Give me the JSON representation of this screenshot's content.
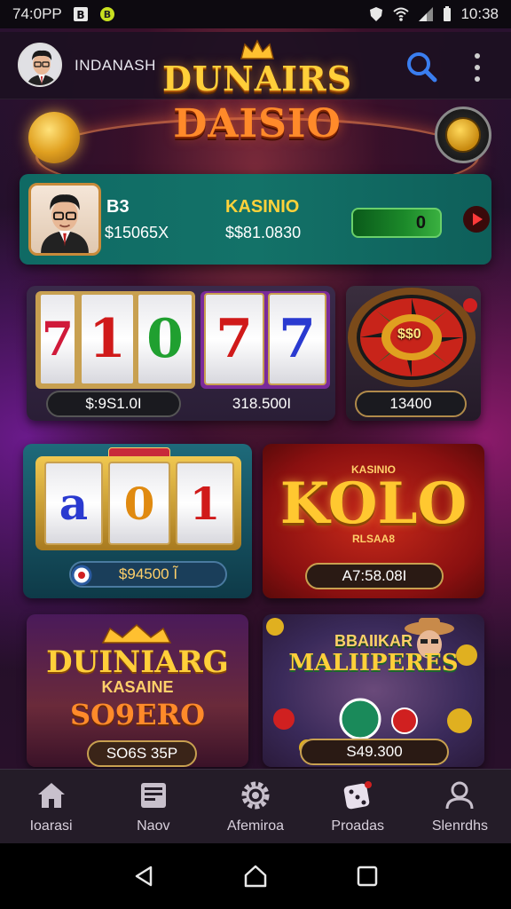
{
  "status_bar": {
    "time_left": "74:0PP",
    "time_right": "10:38"
  },
  "header": {
    "user_name": "INDANASH",
    "logo_line1": "DUNAIRS",
    "logo_line2": "DAISIO"
  },
  "profile": {
    "id": "B3",
    "balance": "$15065X",
    "label": "KASINIO",
    "balance2": "$$81.0830",
    "toggle_value": "0"
  },
  "games": [
    {
      "reels": [
        "7",
        "1",
        "1",
        "0",
        "7",
        "7",
        "7"
      ],
      "price": "$:9S1.0I",
      "price2": "318.500I"
    },
    {
      "title": "$$0",
      "price": "13400"
    },
    {
      "badge": "RŠŠŠŠ",
      "reels": [
        "a",
        "0",
        "1"
      ],
      "price": "$94500 Ĩ"
    },
    {
      "title": "KOLO",
      "top": "KASINIO",
      "bottom": "RLSAA8",
      "price": "A7:58.08I"
    },
    {
      "line1": "DUINIARG",
      "line2": "KASAINE",
      "line3": "SO9ERO",
      "price": "SO6S 35P"
    },
    {
      "line1": "BBAIIKAR",
      "line2": "MALIIPERES",
      "price": "S49.300"
    }
  ],
  "nav": [
    {
      "label": "Ioarasi",
      "icon": "home-icon"
    },
    {
      "label": "Naov",
      "icon": "news-icon"
    },
    {
      "label": "Afemiroa",
      "icon": "gear-icon"
    },
    {
      "label": "Proadas",
      "icon": "dice-icon"
    },
    {
      "label": "Slenrdhs",
      "icon": "user-icon"
    }
  ]
}
